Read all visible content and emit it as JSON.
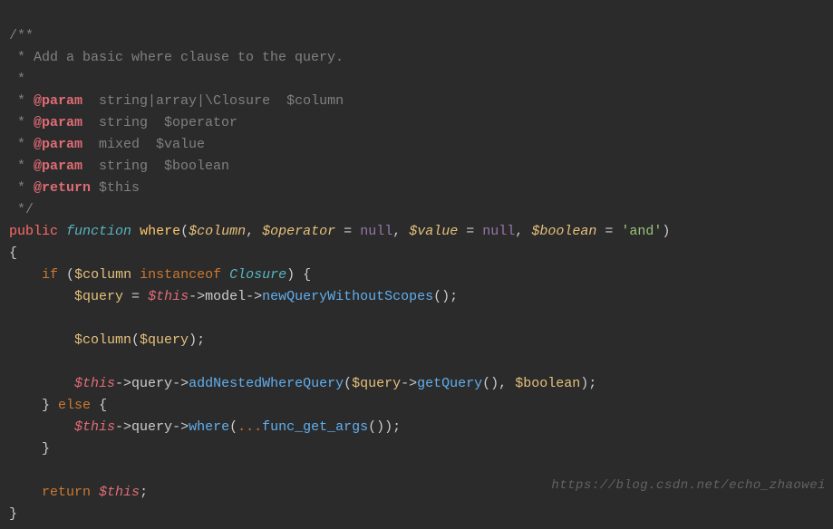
{
  "c1": "/**",
  "c2": " * Add a basic where clause to the query.",
  "c3": " *",
  "c4a": " * ",
  "c4tag": "@param",
  "c4b": "  string|array|\\Closure  $column",
  "c5a": " * ",
  "c5tag": "@param",
  "c5b": "  string  $operator",
  "c6a": " * ",
  "c6tag": "@param",
  "c6b": "  mixed  $value",
  "c7a": " * ",
  "c7tag": "@param",
  "c7b": "  string  $boolean",
  "c8a": " * ",
  "c8tag": "@return",
  "c8b": " $this",
  "c9": " */",
  "kw_public": "public",
  "kw_function": "function",
  "fn_where": "where",
  "p_column": "$column",
  "p_operator": "$operator",
  "p_value": "$value",
  "p_boolean": "$boolean",
  "null1": "null",
  "null2": "null",
  "str_and": "'and'",
  "brace_open": "{",
  "kw_if": "if",
  "kw_instanceof": "instanceof",
  "cls_closure": "Closure",
  "v_query": "$query",
  "v_this": "$this",
  "m_model": "model",
  "m_newquery": "newQueryWithoutScopes",
  "v_column_call": "$column",
  "m_query": "query",
  "m_addnested": "addNestedWhereQuery",
  "m_getquery": "getQuery",
  "v_boolean": "$boolean",
  "kw_else": "else",
  "m_where": "where",
  "m_funcargs": "func_get_args",
  "kw_return": "return",
  "brace_close": "}",
  "watermark": "https://blog.csdn.net/echo_zhaowei"
}
